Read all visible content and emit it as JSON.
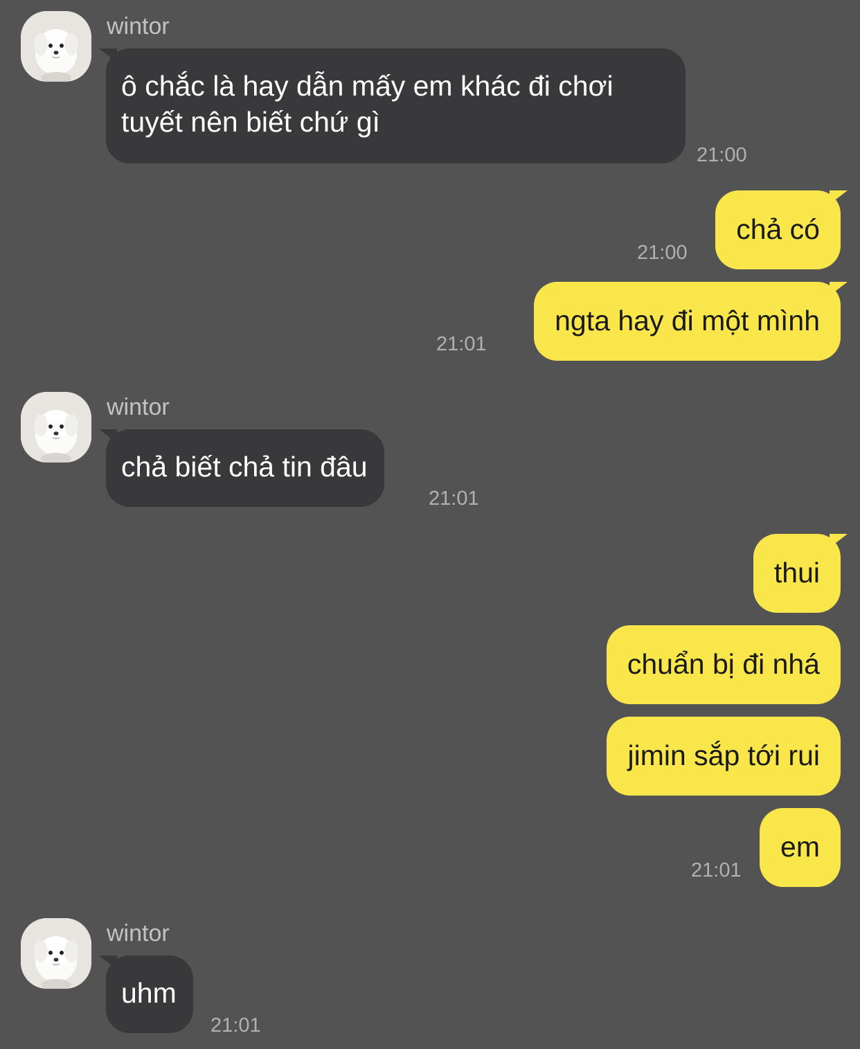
{
  "colors": {
    "background": "#545354",
    "incoming_bubble": "#39383a",
    "outgoing_bubble": "#f9e64b"
  },
  "avatar_icon": "dog-avatar-icon",
  "messages": [
    {
      "sender": "wintor",
      "text": "ô chắc là hay dẫn mấy em khác đi chơi",
      "text2": "tuyết nên biết chứ gì",
      "time": "21:00"
    },
    {
      "text": "chả có",
      "time": "21:00"
    },
    {
      "text": "ngta hay đi một mình",
      "time": "21:01"
    },
    {
      "sender": "wintor",
      "text": "chả biết chả tin đâu",
      "time": "21:01"
    },
    {
      "text": "thui"
    },
    {
      "text": "chuẩn bị đi nhá"
    },
    {
      "text": "jimin sắp tới rui"
    },
    {
      "text": "em",
      "time": "21:01"
    },
    {
      "sender": "wintor",
      "text": "uhm",
      "time": "21:01"
    }
  ]
}
